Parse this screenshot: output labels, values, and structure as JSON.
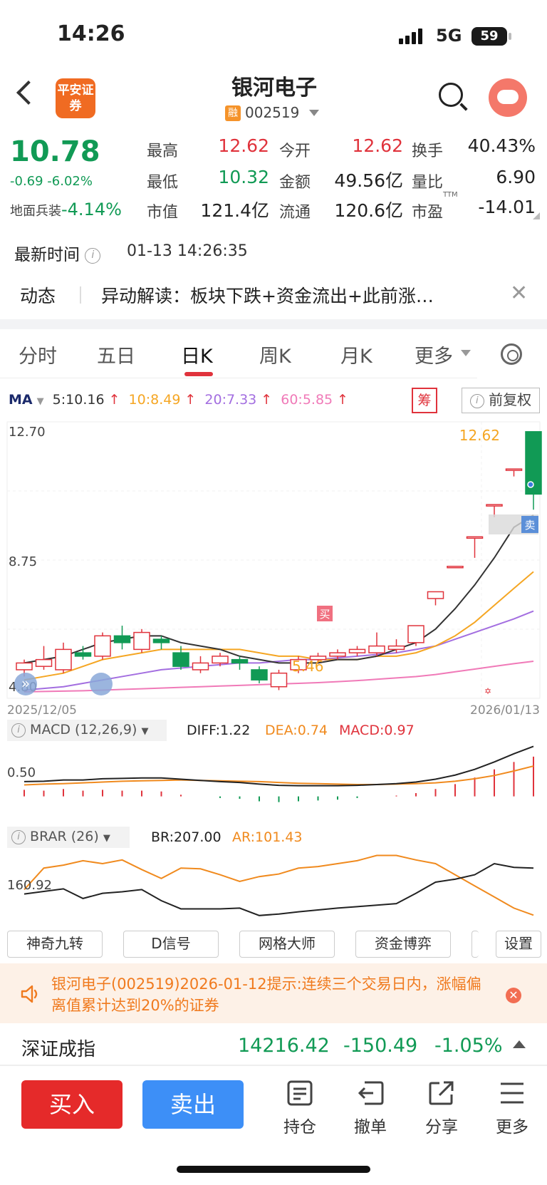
{
  "status_bar": {
    "time": "14:26",
    "network": "5G",
    "battery": "59"
  },
  "header": {
    "logo": "平安证券",
    "title": "银河电子",
    "tag": "融",
    "code": "002519"
  },
  "quote": {
    "price": "10.78",
    "change": "-0.69 -6.02%",
    "sector_name": "地面兵装",
    "sector_change": "-4.14%",
    "fields": [
      {
        "label": "最高",
        "value": "12.62",
        "color": "#e0333c"
      },
      {
        "label": "今开",
        "value": "12.62",
        "color": "#e0333c"
      },
      {
        "label": "换手",
        "value": "40.43%",
        "color": "#222222"
      },
      {
        "label": "最低",
        "value": "10.32",
        "color": "#119a55"
      },
      {
        "label": "金额",
        "value": "49.56亿",
        "color": "#222222"
      },
      {
        "label": "量比",
        "value": "6.90",
        "color": "#222222"
      },
      {
        "label": "市值",
        "value": "121.4亿",
        "color": "#222222"
      },
      {
        "label": "流通",
        "value": "120.6亿",
        "color": "#222222"
      },
      {
        "label": "市盈",
        "value": "-14.01",
        "color": "#222222"
      }
    ],
    "pe_superscript": "TTM"
  },
  "latest": {
    "label": "最新时间",
    "time": "01-13 14:26:35"
  },
  "news": {
    "tag": "动态",
    "text": "异动解读：板块下跌+资金流出+此前涨…"
  },
  "tabs": [
    "分时",
    "五日",
    "日K",
    "周K",
    "月K",
    "更多"
  ],
  "active_tab": "日K",
  "ma_legend": {
    "label": "MA",
    "items": [
      {
        "text": "5:10.16",
        "color": "#333333"
      },
      {
        "text": "10:8.49",
        "color": "#f5a623"
      },
      {
        "text": "20:7.33",
        "color": "#a36ee0"
      },
      {
        "text": "60:5.85",
        "color": "#f07ab8"
      }
    ],
    "chou": "筹",
    "fuquan": "前复权"
  },
  "kline": {
    "y_top_label": "12.70",
    "y_mid_label": "8.75",
    "y_low_label": "4.80",
    "high_marker": "12.62",
    "low_marker": "5.46",
    "buy_marker": "买",
    "sell_marker": "卖",
    "date_start": "2025/12/05",
    "date_end": "2026/01/13",
    "ylim": [
      4.8,
      12.7
    ],
    "candles": [
      [
        5.6,
        5.8,
        5.4,
        5.9
      ],
      [
        5.7,
        5.9,
        5.6,
        6.3
      ],
      [
        5.6,
        6.2,
        5.5,
        6.4
      ],
      [
        6.1,
        6.0,
        5.9,
        6.3
      ],
      [
        6.0,
        6.6,
        5.9,
        6.7
      ],
      [
        6.6,
        6.4,
        6.2,
        6.9
      ],
      [
        6.2,
        6.7,
        6.1,
        6.8
      ],
      [
        6.5,
        6.4,
        6.2,
        6.6
      ],
      [
        6.1,
        5.7,
        5.6,
        6.3
      ],
      [
        5.6,
        5.8,
        5.5,
        6.0
      ],
      [
        5.8,
        6.0,
        5.7,
        6.1
      ],
      [
        5.9,
        5.8,
        5.6,
        6.0
      ],
      [
        5.6,
        5.3,
        5.2,
        5.7
      ],
      [
        5.1,
        5.5,
        5.0,
        5.6
      ],
      [
        5.6,
        5.9,
        5.5,
        6.0
      ],
      [
        5.9,
        6.0,
        5.8,
        6.1
      ],
      [
        6.0,
        6.1,
        5.9,
        6.2
      ],
      [
        6.1,
        6.2,
        6.0,
        6.3
      ],
      [
        6.1,
        6.3,
        6.0,
        6.7
      ],
      [
        6.2,
        6.3,
        6.1,
        6.5
      ],
      [
        6.4,
        6.9,
        6.3,
        6.9
      ],
      [
        7.7,
        7.9,
        7.5,
        7.9
      ],
      [
        8.65,
        8.65,
        8.65,
        8.65
      ],
      [
        9.52,
        9.52,
        8.9,
        9.52
      ],
      [
        10.47,
        10.47,
        10.1,
        10.47
      ],
      [
        11.52,
        11.52,
        11.3,
        11.52
      ],
      [
        12.62,
        10.78,
        10.32,
        12.62
      ]
    ],
    "ma5": [
      5.8,
      5.9,
      6.0,
      6.2,
      6.4,
      6.5,
      6.6,
      6.6,
      6.4,
      6.3,
      6.2,
      6.0,
      5.9,
      5.8,
      5.8,
      5.8,
      5.9,
      5.9,
      6.0,
      6.2,
      6.4,
      6.8,
      7.4,
      8.1,
      8.9,
      9.8,
      10.16
    ],
    "ma10": [
      5.3,
      5.4,
      5.5,
      5.7,
      5.9,
      6.0,
      6.1,
      6.2,
      6.2,
      6.2,
      6.2,
      6.2,
      6.1,
      6.0,
      6.0,
      5.9,
      5.9,
      5.9,
      6.0,
      6.0,
      6.1,
      6.3,
      6.6,
      7.0,
      7.5,
      8.0,
      8.49
    ],
    "ma20": [
      5.0,
      5.05,
      5.1,
      5.2,
      5.3,
      5.4,
      5.5,
      5.6,
      5.65,
      5.7,
      5.75,
      5.8,
      5.8,
      5.85,
      5.9,
      5.9,
      5.95,
      6.0,
      6.05,
      6.1,
      6.2,
      6.3,
      6.5,
      6.7,
      6.9,
      7.1,
      7.33
    ],
    "ma60": [
      4.95,
      4.96,
      4.97,
      4.98,
      5.0,
      5.02,
      5.04,
      5.06,
      5.08,
      5.1,
      5.12,
      5.14,
      5.16,
      5.18,
      5.2,
      5.22,
      5.25,
      5.28,
      5.32,
      5.36,
      5.4,
      5.46,
      5.54,
      5.62,
      5.7,
      5.78,
      5.85
    ]
  },
  "macd": {
    "label": "MACD (12,26,9)",
    "diff_text": "DIFF:1.22",
    "dea_text": "DEA:0.74",
    "macd_text": "MACD:0.97",
    "y_label": "0.50",
    "diff": [
      0.36,
      0.37,
      0.4,
      0.4,
      0.43,
      0.44,
      0.45,
      0.45,
      0.42,
      0.39,
      0.36,
      0.34,
      0.3,
      0.27,
      0.26,
      0.26,
      0.26,
      0.27,
      0.29,
      0.31,
      0.35,
      0.42,
      0.52,
      0.66,
      0.84,
      1.04,
      1.22
    ],
    "dea": [
      0.28,
      0.3,
      0.31,
      0.33,
      0.35,
      0.37,
      0.38,
      0.39,
      0.4,
      0.39,
      0.38,
      0.37,
      0.36,
      0.34,
      0.32,
      0.31,
      0.3,
      0.29,
      0.29,
      0.3,
      0.31,
      0.33,
      0.37,
      0.43,
      0.51,
      0.62,
      0.74
    ],
    "hist": [
      0.16,
      0.14,
      0.18,
      0.14,
      0.16,
      0.14,
      0.14,
      0.12,
      0.04,
      0.0,
      -0.04,
      -0.06,
      -0.12,
      -0.14,
      -0.12,
      -0.1,
      -0.08,
      -0.04,
      0.0,
      0.02,
      0.08,
      0.18,
      0.3,
      0.46,
      0.66,
      0.84,
      0.97
    ]
  },
  "brar": {
    "label": "BRAR (26)",
    "br_text": "BR:207.00",
    "ar_text": "AR:101.43",
    "y_label": "160.92",
    "br": [
      158,
      165,
      172,
      146,
      160,
      164,
      170,
      140,
      118,
      118,
      118,
      120,
      100,
      104,
      110,
      115,
      120,
      124,
      128,
      132,
      160,
      190,
      198,
      210,
      240,
      230,
      228
    ],
    "ar": [
      170,
      228,
      236,
      248,
      240,
      250,
      224,
      200,
      228,
      226,
      210,
      192,
      205,
      212,
      228,
      232,
      240,
      248,
      262,
      262,
      250,
      240,
      210,
      180,
      150,
      120,
      101
    ]
  },
  "tools": [
    "神奇九转",
    "D信号",
    "网格大师",
    "资金博弈",
    "设置"
  ],
  "alert": {
    "text": "银河电子(002519)2026-01-12提示:连续三个交易日内，涨幅偏离值累计达到20%的证券"
  },
  "index": {
    "name": "深证成指",
    "value": "14216.42",
    "change": "-150.49",
    "pct": "-1.05%"
  },
  "bottom_bar": {
    "buy": "买入",
    "sell": "卖出",
    "items": [
      "持仓",
      "撤单",
      "分享",
      "更多"
    ]
  },
  "colors": {
    "up": "#e0333c",
    "down": "#119a55",
    "ma5": "#333333",
    "ma10": "#f5a623",
    "ma20": "#a36ee0",
    "ma60": "#f07ab8",
    "dea": "#f08a1e"
  }
}
